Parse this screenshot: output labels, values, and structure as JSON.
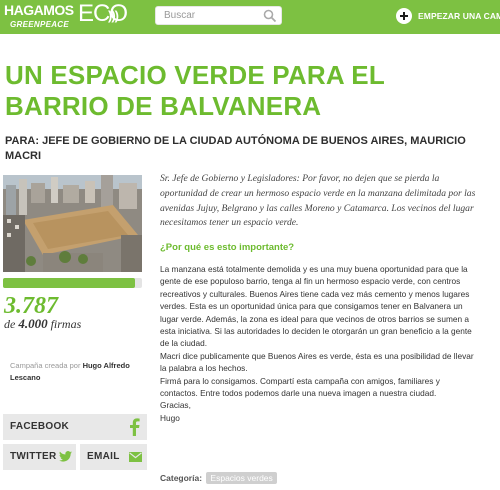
{
  "header": {
    "logo_line1": "HAGAMOS",
    "logo_line2": "GREENPEACE",
    "logo_eco": "ECO",
    "logo_waves": ")))",
    "search_placeholder": "Buscar",
    "start_campaign_label": "EMPEZAR UNA CAMP"
  },
  "campaign": {
    "title": "UN ESPACIO VERDE PARA EL BARRIO DE BALVANERA",
    "recipient": "PARA: JEFE DE GOBIERNO DE LA CIUDAD AUTÓNOMA DE BUENOS AIRES, MAURICIO MACRI",
    "lead": "Sr. Jefe de Gobierno y Legisladores: Por favor, no dejen que se pierda la oportunidad de crear un hermoso espacio verde en  la manzana delimitada por las avenidas Jujuy, Belgrano y las calles Moreno y Catamarca. Los vecinos del lugar necesitamos tener un espacio verde.",
    "why_heading": "¿Por qué es esto importante?",
    "body_paragraphs": [
      "La manzana está totalmente demolida y es una muy buena oportunidad para que la gente de ese populoso barrio, tenga al fin un hermoso espacio verde, con centros recreativos y culturales. Buenos Aires tiene cada vez más cemento y menos lugares verdes. Esta es un oportunidad única para que consigamos tener en Balvanera un lugar verde.  Además, la zona es ideal para que vecinos de otros barrios se sumen a esta iniciativa. Si las autoridades lo deciden le otorgarán un gran beneficio a la gente de la ciudad.",
      "Macri dice publicamente que Buenos Aires es verde, ésta es una posibilidad de llevar la palabra a los hechos.",
      "Firmá para lo consigamos. Compartí esta campaña con amigos, familiares y contactos. Entre todos podemos darle una nueva imagen a nuestra ciudad.",
      "Gracias,",
      "Hugo"
    ],
    "category_label": "Categoría:",
    "category_value": "Espacios verdes"
  },
  "progress": {
    "fraction": 0.947,
    "signatures": "3.787",
    "goal_prefix": "de",
    "goal_number": "4.000",
    "goal_suffix": "firmas"
  },
  "creator": {
    "prefix": "Campaña creada por",
    "name": "Hugo Alfredo Lescano"
  },
  "share": {
    "facebook": "FACEBOOK",
    "twitter": "TWITTER",
    "email": "EMAIL"
  },
  "colors": {
    "brand_green": "#7dc142",
    "title_green": "#6dbb2f",
    "share_bg": "#e8e8e8"
  }
}
